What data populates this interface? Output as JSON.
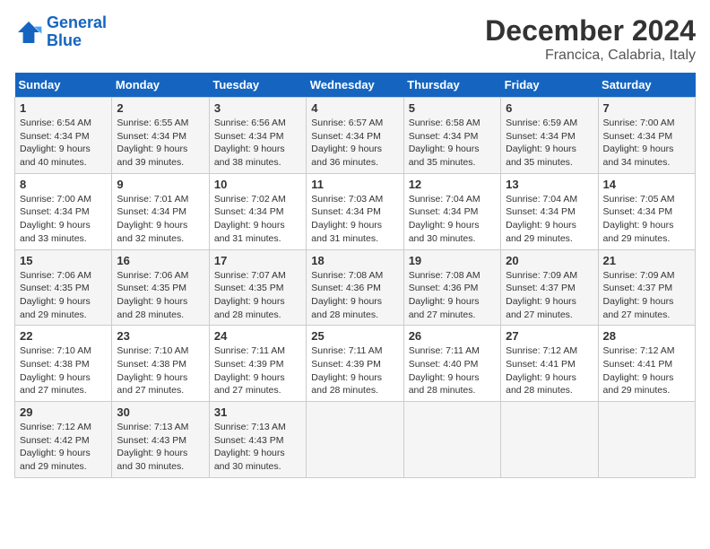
{
  "logo": {
    "line1": "General",
    "line2": "Blue"
  },
  "title": "December 2024",
  "subtitle": "Francica, Calabria, Italy",
  "days_of_week": [
    "Sunday",
    "Monday",
    "Tuesday",
    "Wednesday",
    "Thursday",
    "Friday",
    "Saturday"
  ],
  "weeks": [
    [
      {
        "day": "1",
        "sunrise": "6:54 AM",
        "sunset": "4:34 PM",
        "daylight": "9 hours and 40 minutes."
      },
      {
        "day": "2",
        "sunrise": "6:55 AM",
        "sunset": "4:34 PM",
        "daylight": "9 hours and 39 minutes."
      },
      {
        "day": "3",
        "sunrise": "6:56 AM",
        "sunset": "4:34 PM",
        "daylight": "9 hours and 38 minutes."
      },
      {
        "day": "4",
        "sunrise": "6:57 AM",
        "sunset": "4:34 PM",
        "daylight": "9 hours and 36 minutes."
      },
      {
        "day": "5",
        "sunrise": "6:58 AM",
        "sunset": "4:34 PM",
        "daylight": "9 hours and 35 minutes."
      },
      {
        "day": "6",
        "sunrise": "6:59 AM",
        "sunset": "4:34 PM",
        "daylight": "9 hours and 35 minutes."
      },
      {
        "day": "7",
        "sunrise": "7:00 AM",
        "sunset": "4:34 PM",
        "daylight": "9 hours and 34 minutes."
      }
    ],
    [
      {
        "day": "8",
        "sunrise": "7:00 AM",
        "sunset": "4:34 PM",
        "daylight": "9 hours and 33 minutes."
      },
      {
        "day": "9",
        "sunrise": "7:01 AM",
        "sunset": "4:34 PM",
        "daylight": "9 hours and 32 minutes."
      },
      {
        "day": "10",
        "sunrise": "7:02 AM",
        "sunset": "4:34 PM",
        "daylight": "9 hours and 31 minutes."
      },
      {
        "day": "11",
        "sunrise": "7:03 AM",
        "sunset": "4:34 PM",
        "daylight": "9 hours and 31 minutes."
      },
      {
        "day": "12",
        "sunrise": "7:04 AM",
        "sunset": "4:34 PM",
        "daylight": "9 hours and 30 minutes."
      },
      {
        "day": "13",
        "sunrise": "7:04 AM",
        "sunset": "4:34 PM",
        "daylight": "9 hours and 29 minutes."
      },
      {
        "day": "14",
        "sunrise": "7:05 AM",
        "sunset": "4:34 PM",
        "daylight": "9 hours and 29 minutes."
      }
    ],
    [
      {
        "day": "15",
        "sunrise": "7:06 AM",
        "sunset": "4:35 PM",
        "daylight": "9 hours and 29 minutes."
      },
      {
        "day": "16",
        "sunrise": "7:06 AM",
        "sunset": "4:35 PM",
        "daylight": "9 hours and 28 minutes."
      },
      {
        "day": "17",
        "sunrise": "7:07 AM",
        "sunset": "4:35 PM",
        "daylight": "9 hours and 28 minutes."
      },
      {
        "day": "18",
        "sunrise": "7:08 AM",
        "sunset": "4:36 PM",
        "daylight": "9 hours and 28 minutes."
      },
      {
        "day": "19",
        "sunrise": "7:08 AM",
        "sunset": "4:36 PM",
        "daylight": "9 hours and 27 minutes."
      },
      {
        "day": "20",
        "sunrise": "7:09 AM",
        "sunset": "4:37 PM",
        "daylight": "9 hours and 27 minutes."
      },
      {
        "day": "21",
        "sunrise": "7:09 AM",
        "sunset": "4:37 PM",
        "daylight": "9 hours and 27 minutes."
      }
    ],
    [
      {
        "day": "22",
        "sunrise": "7:10 AM",
        "sunset": "4:38 PM",
        "daylight": "9 hours and 27 minutes."
      },
      {
        "day": "23",
        "sunrise": "7:10 AM",
        "sunset": "4:38 PM",
        "daylight": "9 hours and 27 minutes."
      },
      {
        "day": "24",
        "sunrise": "7:11 AM",
        "sunset": "4:39 PM",
        "daylight": "9 hours and 27 minutes."
      },
      {
        "day": "25",
        "sunrise": "7:11 AM",
        "sunset": "4:39 PM",
        "daylight": "9 hours and 28 minutes."
      },
      {
        "day": "26",
        "sunrise": "7:11 AM",
        "sunset": "4:40 PM",
        "daylight": "9 hours and 28 minutes."
      },
      {
        "day": "27",
        "sunrise": "7:12 AM",
        "sunset": "4:41 PM",
        "daylight": "9 hours and 28 minutes."
      },
      {
        "day": "28",
        "sunrise": "7:12 AM",
        "sunset": "4:41 PM",
        "daylight": "9 hours and 29 minutes."
      }
    ],
    [
      {
        "day": "29",
        "sunrise": "7:12 AM",
        "sunset": "4:42 PM",
        "daylight": "9 hours and 29 minutes."
      },
      {
        "day": "30",
        "sunrise": "7:13 AM",
        "sunset": "4:43 PM",
        "daylight": "9 hours and 30 minutes."
      },
      {
        "day": "31",
        "sunrise": "7:13 AM",
        "sunset": "4:43 PM",
        "daylight": "9 hours and 30 minutes."
      },
      null,
      null,
      null,
      null
    ]
  ]
}
